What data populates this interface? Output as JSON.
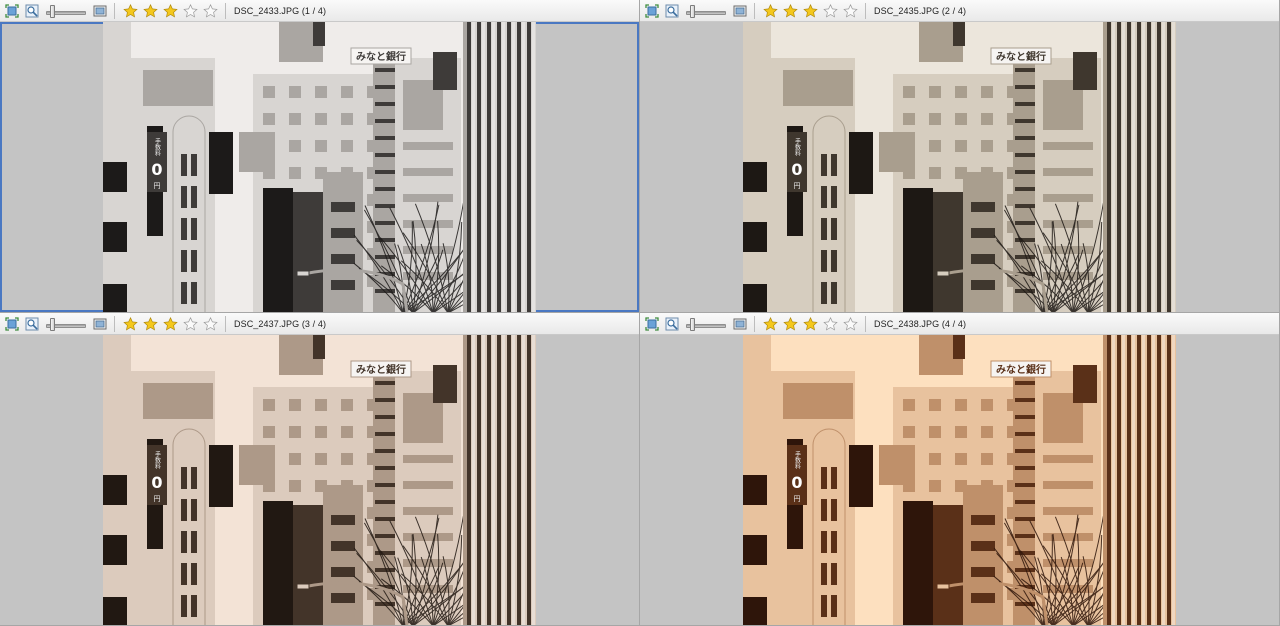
{
  "panes": [
    {
      "filename": "DSC_2433.JPG (1 / 4)",
      "rating": 3,
      "max_rating": 5,
      "zoom_level": 0.1,
      "active": true,
      "tone": {
        "sky": "#efecea",
        "light": "#d8d5d2",
        "mid": "#aaa6a2",
        "dark": "#3e3b39",
        "deep": "#1c1a19"
      }
    },
    {
      "filename": "DSC_2435.JPG (2 / 4)",
      "rating": 3,
      "max_rating": 5,
      "zoom_level": 0.1,
      "active": false,
      "tone": {
        "sky": "#ece6dc",
        "light": "#d6cdbf",
        "mid": "#a99e8e",
        "dark": "#3f372e",
        "deep": "#1d1814"
      }
    },
    {
      "filename": "DSC_2437.JPG (3 / 4)",
      "rating": 3,
      "max_rating": 5,
      "zoom_level": 0.1,
      "active": false,
      "tone": {
        "sky": "#f3e3d6",
        "light": "#dccbbd",
        "mid": "#ad9988",
        "dark": "#433429",
        "deep": "#211812"
      }
    },
    {
      "filename": "DSC_2438.JPG (4 / 4)",
      "rating": 3,
      "max_rating": 5,
      "zoom_level": 0.1,
      "active": false,
      "tone": {
        "sky": "#fde0bf",
        "light": "#e8c29e",
        "mid": "#bf906a",
        "dark": "#5a3018",
        "deep": "#2e150a"
      }
    }
  ],
  "toolbar": {
    "icons": [
      "fit-to-window-icon",
      "zoom-in-icon",
      "zoom-slider",
      "actual-size-icon"
    ]
  },
  "photo_text": {
    "bank_sign": "みなと銀行",
    "banner_top": "手数料",
    "banner_zero": "0",
    "banner_unit": "円"
  }
}
